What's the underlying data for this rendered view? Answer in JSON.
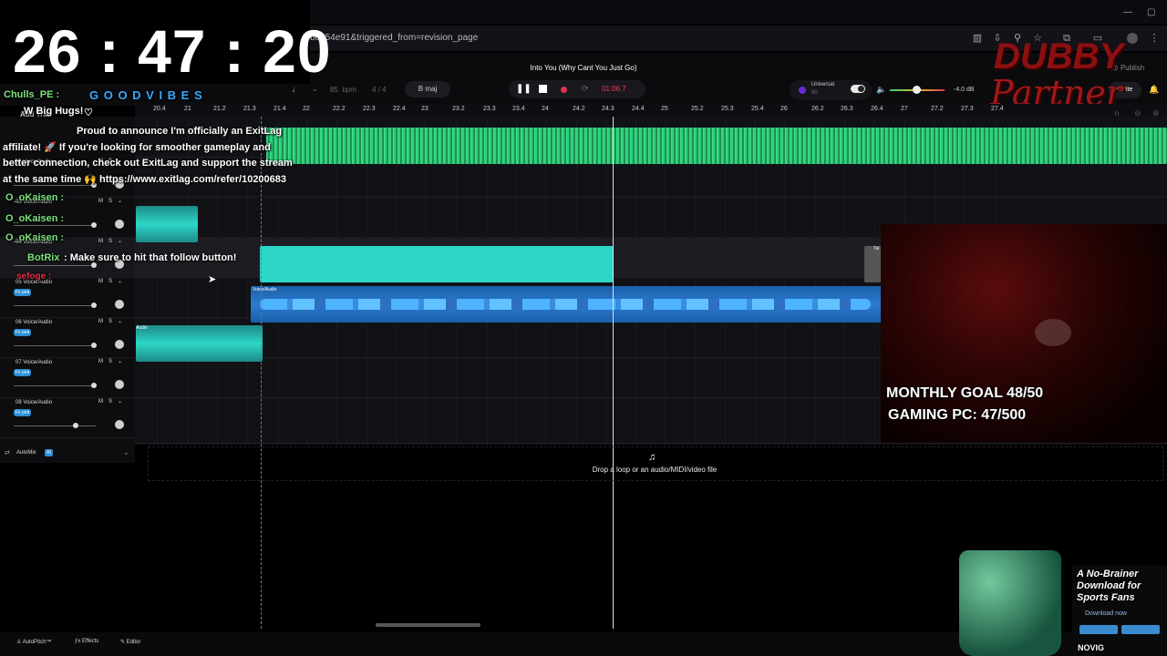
{
  "clock": {
    "time": "26 : 47 : 20"
  },
  "browser": {
    "url": "bd354e91&triggered_from=revision_page"
  },
  "header": {
    "song_title": "Into You (Why Cant You Just Go)",
    "bpm_value": "85",
    "bpm_unit": "bpm",
    "time_signature": "4 / 4",
    "key": "B maj",
    "time_readout": "01:06.7",
    "universal_label": "Universal",
    "universal_value": "50",
    "volume_db": "-4.0 dB",
    "publish_label": "Publish",
    "invite_label": "Invite"
  },
  "ruler": {
    "ticks": [
      "20.4",
      "21",
      "21.2",
      "21.3",
      "21.4",
      "22",
      "22.2",
      "22.3",
      "22.4",
      "23",
      "23.2",
      "23.3",
      "23.4",
      "24",
      "24.2",
      "24.3",
      "24.4",
      "25",
      "25.2",
      "25.3",
      "25.4",
      "26",
      "26.2",
      "26.3",
      "26.4",
      "27",
      "27.2",
      "27.3",
      "27.4"
    ]
  },
  "tracks": [
    {
      "num": "02",
      "name": "Voice/Audio",
      "fx": ""
    },
    {
      "num": "03",
      "name": "Voice/Audio",
      "fx": ""
    },
    {
      "num": "04",
      "name": "Voice/Audio",
      "fx": ""
    },
    {
      "num": "05",
      "name": "Voice/Audio",
      "fx": "Fx pnd"
    },
    {
      "num": "06",
      "name": "Voice/Audio",
      "fx": "Fx pnd"
    },
    {
      "num": "07",
      "name": "Voice/Audio",
      "fx": "Fx pnd"
    },
    {
      "num": "08",
      "name": "Voice/Audio",
      "fx": "Fx pnd"
    }
  ],
  "track_buttons": {
    "mute": "M",
    "solo": "S"
  },
  "clips": {
    "voice_audio_label": "Voice/Audio",
    "audio_label": "Audio",
    "tal_label": "Tal"
  },
  "automix": {
    "label": "AutoMix",
    "badge": "AI"
  },
  "drop_zone": {
    "text": "Drop a loop or an audio/MIDI/video file"
  },
  "bottom_bar": {
    "autopitch": "AutoPitch™",
    "effects": "Effects",
    "editor": "Editor"
  },
  "chat": {
    "user1": "Chulls_PE :",
    "user1_msg": "G O O D V I B E S",
    "add_track": "Add Trac",
    "big_hugs": "W Big Hugs!",
    "announce_1": "Proud to announce I'm officially an ExitLag",
    "announce_2": "affiliate! 🚀 If you're looking for smoother gameplay and",
    "announce_3": "better connection, check out ExitLag and support the stream",
    "announce_4": "at the same time 🙌 https://www.exitlag.com/refer/10200683",
    "user2": "O_oKaisen :",
    "user3": "O_oKaisen :",
    "user4": "O_oKaisen :",
    "botrix": "BotRix",
    "botrix_msg": ": Make sure to hit that follow button!",
    "user5": "sefoge :"
  },
  "goals": {
    "monthly": "MONTHLY GOAL 48/50",
    "gaming_pc": "GAMING PC: 47/500"
  },
  "ad": {
    "headline_1": "A No-Brainer",
    "headline_2": "Download for",
    "headline_3": "Sports Fans",
    "cta": "Download now",
    "brand": "NOVIG"
  },
  "logo": {
    "line1": "DUBBY",
    "line2": "Partner"
  },
  "colors": {
    "accent": "#2dd7c8",
    "green_wave": "#2fcf78",
    "blue_wave": "#2c9fe8",
    "record": "#e0324a"
  }
}
